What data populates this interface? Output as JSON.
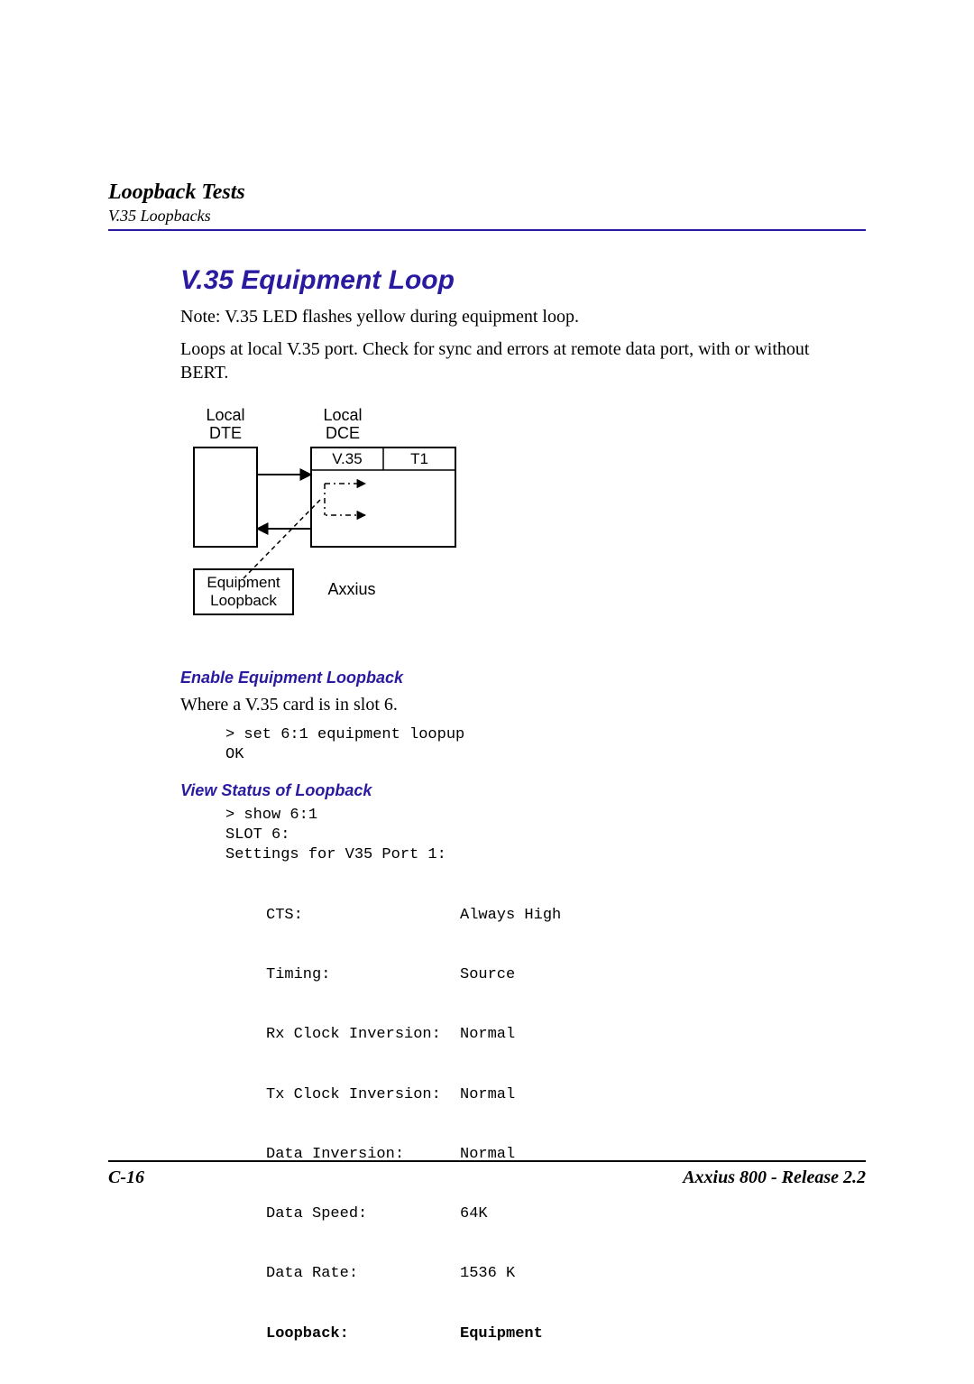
{
  "header": {
    "title": "Loopback Tests",
    "subtitle": "V.35 Loopbacks"
  },
  "section": {
    "heading": "V.35 Equipment Loop",
    "note": "Note: V.35 LED flashes yellow during equipment loop.",
    "desc": "Loops at local V.35 port. Check for sync and errors at remote data port, with or without BERT."
  },
  "diagram": {
    "local_dte_1": "Local",
    "local_dte_2": "DTE",
    "local_dce_1": "Local",
    "local_dce_2": "DCE",
    "v35": "V.35",
    "t1": "T1",
    "eq_loop_1": "Equipment",
    "eq_loop_2": "Loopback",
    "axxius": "Axxius"
  },
  "enable": {
    "heading": "Enable Equipment Loopback",
    "where": "Where a V.35 card is in slot 6.",
    "cmd": "> set 6:1 equipment loopup\nOK"
  },
  "view": {
    "heading": "View Status of Loopback",
    "pre": "> show 6:1\nSLOT 6:\nSettings for V35 Port 1:",
    "rows": [
      {
        "label": "CTS:",
        "value": "Always High"
      },
      {
        "label": "Timing:",
        "value": "Source"
      },
      {
        "label": "Rx Clock Inversion:",
        "value": "Normal"
      },
      {
        "label": "Tx Clock Inversion:",
        "value": "Normal"
      },
      {
        "label": "Data Inversion:",
        "value": "Normal"
      },
      {
        "label": "Data Speed:",
        "value": "64K"
      },
      {
        "label": "Data Rate:",
        "value": "1536 K"
      }
    ],
    "bold_row": {
      "label": "Loopback:",
      "value": "Equipment"
    }
  },
  "footer": {
    "left": "C-16",
    "right": "Axxius 800 - Release 2.2"
  }
}
